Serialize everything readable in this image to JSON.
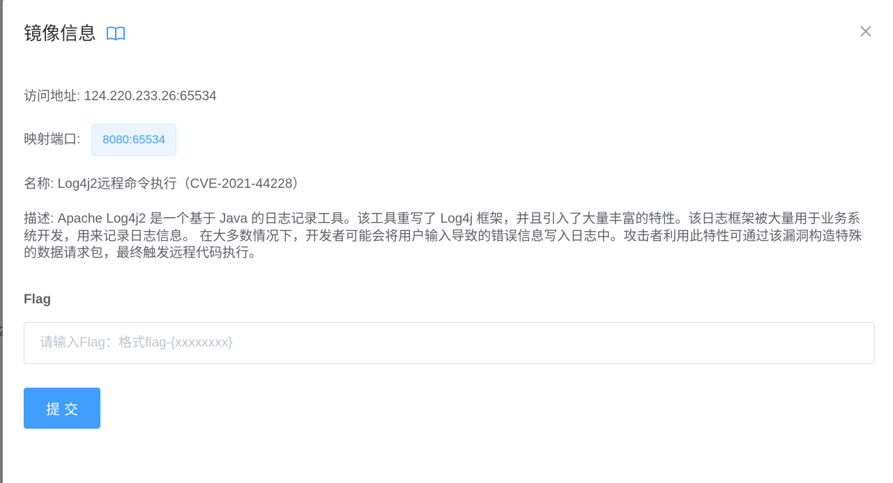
{
  "dialog": {
    "title": "镜像信息",
    "accent_color": "#409eff"
  },
  "info": {
    "address_label": "访问地址:",
    "address_value": "124.220.233.26:65534",
    "port_label": "映射端口:",
    "port_tag": "8080:65534",
    "name_label": "名称:",
    "name_value": "Log4j2远程命令执行（CVE-2021-44228）",
    "desc_label": "描述:",
    "desc_value": "Apache Log4j2 是一个基于 Java 的日志记录工具。该工具重写了 Log4j 框架，并且引入了大量丰富的特性。该日志框架被大量用于业务系统开发，用来记录日志信息。 在大多数情况下，开发者可能会将用户输入导致的错误信息写入日志中。攻击者利用此特性可通过该漏洞构造特殊的数据请求包，最终触发远程代码执行。"
  },
  "form": {
    "flag_label": "Flag",
    "flag_placeholder": "请输入Flag：格式flag-{xxxxxxxx}",
    "flag_value": "",
    "submit_label": "提交"
  },
  "icons": {
    "title_icon": "book-open-icon",
    "close_icon": "close-icon"
  },
  "backdrop": {
    "partial_char": "2"
  }
}
